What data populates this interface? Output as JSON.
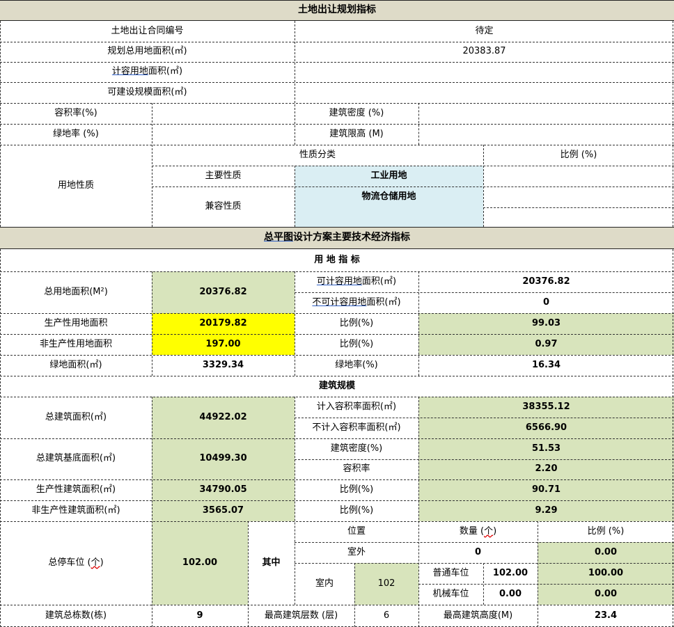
{
  "title1": "土地出让规划指标",
  "contract": {
    "label": "土地出让合同编号",
    "value": "待定"
  },
  "plan_area": {
    "label": "规划总用地面积(㎡)",
    "value": "20383.87"
  },
  "calc_area": {
    "label_u": "计容用地",
    "label_rest": "面积(㎡)"
  },
  "build_area": {
    "label": "可建设规模面积(㎡)"
  },
  "far": {
    "label": "容积率(%)"
  },
  "density": {
    "label": "建筑密度 (%)"
  },
  "green_rate": {
    "label": "绿地率 (%)"
  },
  "height_limit": {
    "label": "建筑限高 (M)"
  },
  "land_nature": {
    "label": "用地性质",
    "col_type": "性质分类",
    "col_ratio": "比例 (%)",
    "main_label": "主要性质",
    "main_value": "工业用地",
    "compat_label": "兼容性质",
    "compat_value": "物流仓储用地"
  },
  "title2_u": "总平图",
  "title2_rest": "设计方案主要技术经济指标",
  "sec_land": "用 地 指 标",
  "total_land": {
    "label": "总用地面积(M²)",
    "value": "20376.82"
  },
  "calc_land": {
    "label_pre": "可计容用地",
    "label_post": "面积(㎡)",
    "value": "20376.82"
  },
  "noncalc_land": {
    "label_pre": "不可计容用地",
    "label_post": "面积(㎡)",
    "value": "0"
  },
  "prod_land": {
    "label": "生产性用地面积",
    "value": "20179.82",
    "ratio_label": "比例(%)",
    "ratio": "99.03"
  },
  "nonprod_land": {
    "label": "非生产性用地面积",
    "value": "197.00",
    "ratio_label": "比例(%)",
    "ratio": "0.97"
  },
  "green_area": {
    "label": "绿地面积(㎡)",
    "value": "3329.34",
    "rate_label": "绿地率(%)",
    "rate": "16.34"
  },
  "sec_build": "建筑规模",
  "total_build": {
    "label": "总建筑面积(㎡)",
    "value": "44922.02"
  },
  "far_area": {
    "label": "计入容积率面积(㎡)",
    "value": "38355.12"
  },
  "nonfar_area": {
    "label": "不计入容积率面积(㎡)",
    "value": "6566.90"
  },
  "base_area": {
    "label": "总建筑基底面积(㎡)",
    "value": "10499.30"
  },
  "density_val": {
    "label": "建筑密度(%)",
    "value": "51.53"
  },
  "far_val": {
    "label": "容积率",
    "value": "2.20"
  },
  "prod_build": {
    "label": "生产性建筑面积(㎡)",
    "value": "34790.05",
    "ratio_label": "比例(%)",
    "ratio": "90.71"
  },
  "nonprod_build": {
    "label": "非生产性建筑面积(㎡)",
    "value": "3565.07",
    "ratio_label": "比例(%)",
    "ratio": "9.29"
  },
  "parking": {
    "label_pre": "总停车位 (",
    "label_unit": "个",
    "label_post": ")",
    "value": "102.00",
    "among": "其中",
    "col_pos": "位置",
    "col_qty_pre": "数量 (",
    "col_qty_unit": "个",
    "col_qty_post": ")",
    "col_ratio": "比例 (%)",
    "outdoor": "室外",
    "outdoor_qty": "0",
    "outdoor_ratio": "0.00",
    "indoor": "室内",
    "indoor_qty": "102",
    "normal": "普通车位",
    "normal_qty": "102.00",
    "normal_ratio": "100.00",
    "mech": "机械车位",
    "mech_qty": "0.00",
    "mech_ratio": "0.00"
  },
  "bottom": {
    "bldg_count_label": "建筑总栋数(栋)",
    "bldg_count": "9",
    "max_floors_label": "最高建筑层数 (层)",
    "max_floors": "6",
    "max_height_label": "最高建筑高度(M)",
    "max_height": "23.4"
  },
  "colors": {
    "header_bg": "#dedbc8",
    "green_fill": "#d8e4bc",
    "yellow_fill": "#ffff00",
    "blue_fill": "#daeef3"
  }
}
